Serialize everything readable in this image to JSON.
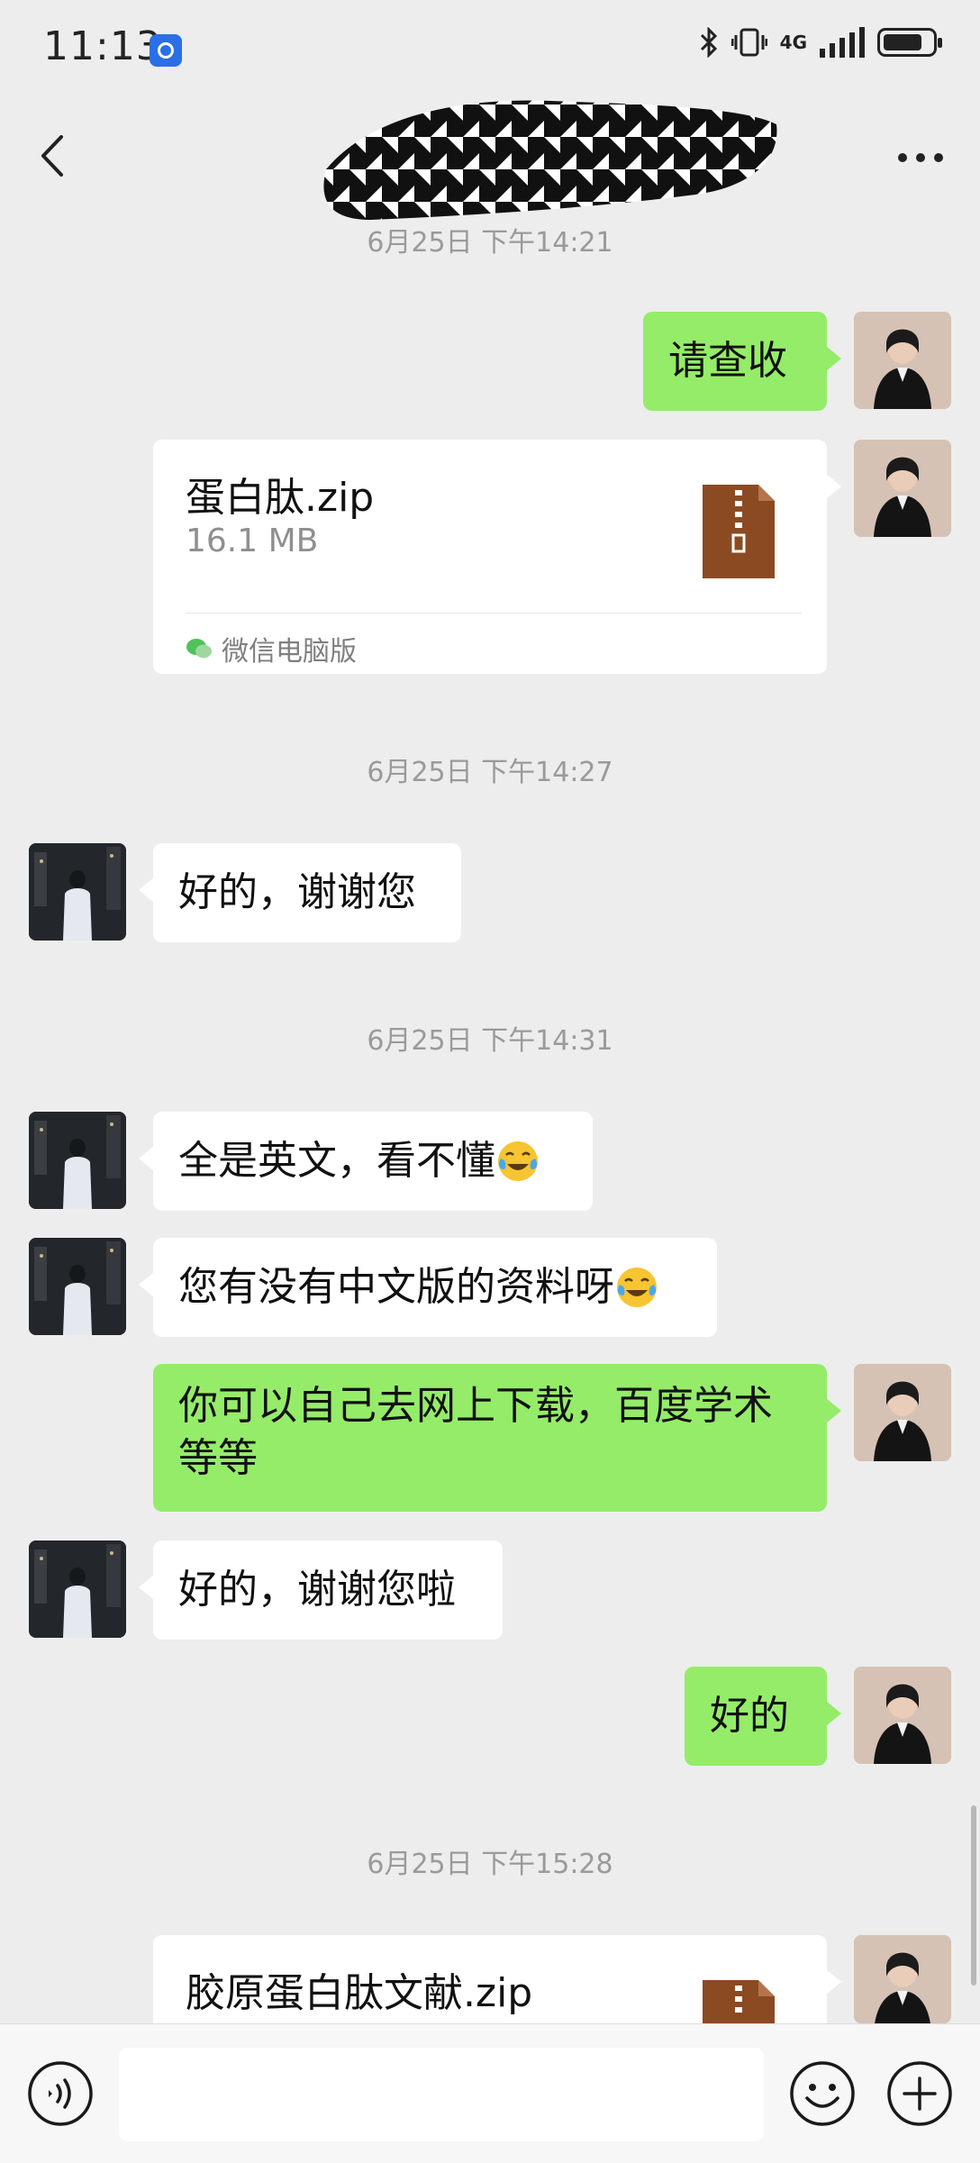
{
  "status_bar": {
    "time": "11:13",
    "network": "4G"
  },
  "header": {
    "title_redacted": true
  },
  "messages": [
    {
      "type": "timestamp",
      "text": "6月25日 下午14:21"
    },
    {
      "type": "text",
      "from": "me",
      "text": "请查收"
    },
    {
      "type": "file",
      "from": "me",
      "file_name": "蛋白肽.zip",
      "file_size": "16.1 MB",
      "source": "微信电脑版"
    },
    {
      "type": "timestamp",
      "text": "6月25日 下午14:27"
    },
    {
      "type": "text",
      "from": "other",
      "text": "好的，谢谢您"
    },
    {
      "type": "timestamp",
      "text": "6月25日 下午14:31"
    },
    {
      "type": "text",
      "from": "other",
      "text": "全是英文，看不懂",
      "emoji": "crying-laughing-emoji"
    },
    {
      "type": "text",
      "from": "other",
      "text": "您有没有中文版的资料呀",
      "emoji": "crying-laughing-emoji"
    },
    {
      "type": "text",
      "from": "me",
      "line1": "你可以自己去网上下载，百度学术",
      "line2": "等等"
    },
    {
      "type": "text",
      "from": "other",
      "text": "好的，谢谢您啦"
    },
    {
      "type": "text",
      "from": "me",
      "text": "好的"
    },
    {
      "type": "timestamp",
      "text": "6月25日 下午15:28"
    },
    {
      "type": "file",
      "from": "me",
      "file_name": "胶原蛋白肽文献.zip"
    }
  ],
  "input_bar": {
    "value": "",
    "icons": [
      "voice-icon",
      "emoji-icon",
      "plus-icon"
    ]
  },
  "colors": {
    "background": "#ededed",
    "my_bubble": "#95ec69",
    "other_bubble": "#ffffff",
    "timestamp": "#9a9a9a"
  }
}
